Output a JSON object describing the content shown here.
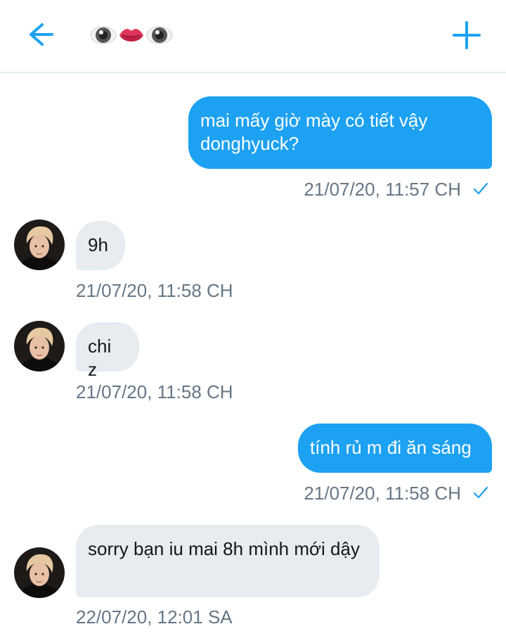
{
  "header": {
    "back_icon": "arrow-left-icon",
    "title_emojis": [
      "eye",
      "lips",
      "eye"
    ],
    "new_icon": "plus-icon",
    "accent": "#1da1f2"
  },
  "messages": [
    {
      "side": "out",
      "text": "mai mấy giờ mày có tiết vậy donghyuck?",
      "time": "21/07/20, 11:57 CH",
      "read": true
    },
    {
      "side": "in",
      "text": "9h",
      "time": "21/07/20, 11:58 CH"
    },
    {
      "side": "in",
      "text": "chi z",
      "time": "21/07/20, 11:58 CH"
    },
    {
      "side": "out",
      "text": "tính rủ m đi ăn sáng",
      "time": "21/07/20, 11:58 CH",
      "read": true
    },
    {
      "side": "in",
      "text": "sorry bạn iu mai 8h mình mới dậy",
      "time": "22/07/20, 12:01 SA"
    }
  ]
}
